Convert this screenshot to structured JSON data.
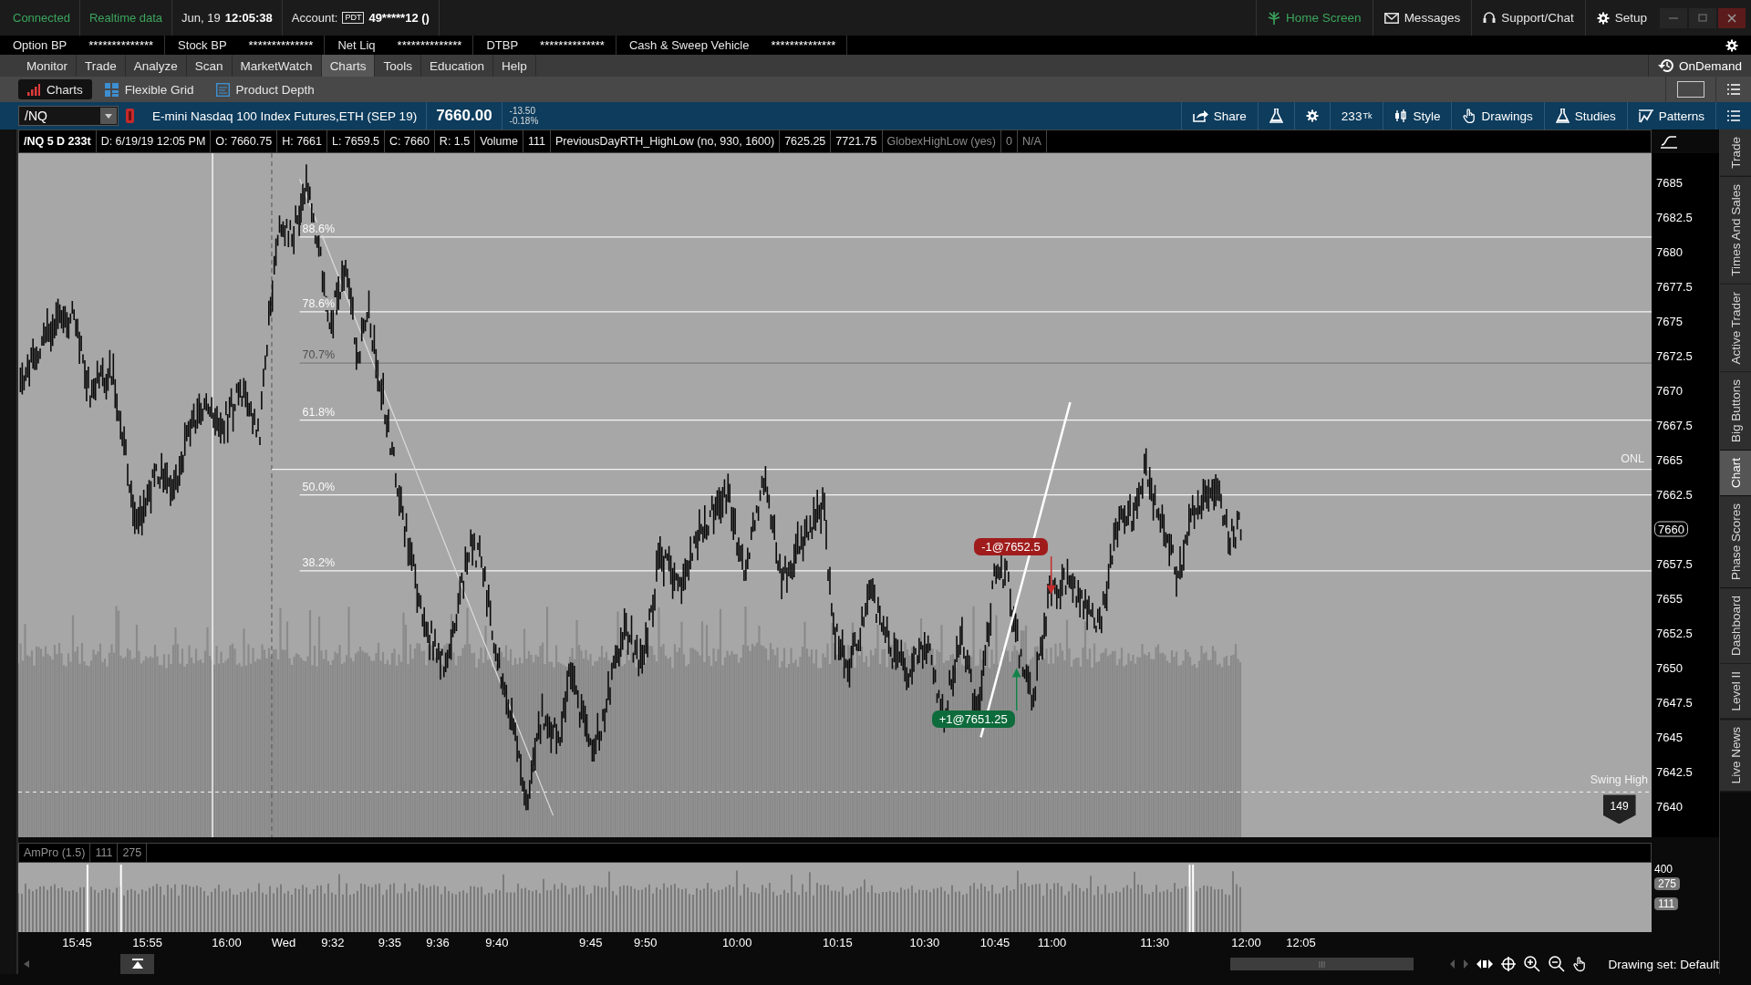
{
  "status_bar": {
    "connection": "Connected",
    "data_feed": "Realtime data",
    "date": "Jun, 19",
    "time": "12:05:38",
    "account_label": "Account:",
    "account_badge": "PDT",
    "account": "49*****12 ()"
  },
  "header_links": [
    {
      "label": "Home Screen",
      "selected": true
    },
    {
      "label": "Messages",
      "selected": false
    },
    {
      "label": "Support/Chat",
      "selected": false
    },
    {
      "label": "Setup",
      "selected": false
    }
  ],
  "balances": [
    {
      "label": "Option BP",
      "value": "**************"
    },
    {
      "label": "Stock BP",
      "value": "**************"
    },
    {
      "label": "Net Liq",
      "value": "**************"
    },
    {
      "label": "DTBP",
      "value": "**************"
    },
    {
      "label": "Cash & Sweep Vehicle",
      "value": "**************"
    }
  ],
  "main_tabs": [
    {
      "label": "Monitor",
      "selected": false
    },
    {
      "label": "Trade",
      "selected": false
    },
    {
      "label": "Analyze",
      "selected": false
    },
    {
      "label": "Scan",
      "selected": false
    },
    {
      "label": "MarketWatch",
      "selected": false
    },
    {
      "label": "Charts",
      "selected": true
    },
    {
      "label": "Tools",
      "selected": false
    },
    {
      "label": "Education",
      "selected": false
    },
    {
      "label": "Help",
      "selected": false
    }
  ],
  "on_demand": "OnDemand",
  "sub_tabs": [
    {
      "label": "Charts",
      "selected": true
    },
    {
      "label": "Flexible Grid",
      "selected": false
    },
    {
      "label": "Product Depth",
      "selected": false
    }
  ],
  "symbol": {
    "value": "/NQ",
    "description": "E-mini Nasdaq 100 Index Futures,ETH (SEP 19)",
    "price": "7660.00",
    "change": "-13.50",
    "change_pct": "-0.18%"
  },
  "chart_toolbar": {
    "share": "Share",
    "aggregation": "233",
    "aggregation_unit": "Tk",
    "buttons": [
      "Style",
      "Drawings",
      "Studies",
      "Patterns"
    ]
  },
  "info_bar": [
    {
      "text": "/NQ 5 D 233t",
      "kind": "title"
    },
    {
      "text": "D: 6/19/19 12:05 PM",
      "kind": "value"
    },
    {
      "text": "O: 7660.75",
      "kind": "value"
    },
    {
      "text": "H: 7661",
      "kind": "value"
    },
    {
      "text": "L: 7659.5",
      "kind": "value"
    },
    {
      "text": "C: 7660",
      "kind": "value"
    },
    {
      "text": "R: 1.5",
      "kind": "value"
    },
    {
      "text": "Volume",
      "kind": "value"
    },
    {
      "text": "111",
      "kind": "value"
    },
    {
      "text": "PreviousDayRTH_HighLow (no, 930, 1600)",
      "kind": "value"
    },
    {
      "text": "7625.25",
      "kind": "value"
    },
    {
      "text": "7721.75",
      "kind": "value"
    },
    {
      "text": "GlobexHighLow (yes)",
      "kind": "dim"
    },
    {
      "text": "0",
      "kind": "dim"
    },
    {
      "text": "N/A",
      "kind": "dim"
    }
  ],
  "chart": {
    "price_axis": [
      {
        "label": "7685",
        "current": false
      },
      {
        "label": "7682.5",
        "current": false
      },
      {
        "label": "7680",
        "current": false
      },
      {
        "label": "7677.5",
        "current": false
      },
      {
        "label": "7675",
        "current": false
      },
      {
        "label": "7672.5",
        "current": false
      },
      {
        "label": "7670",
        "current": false
      },
      {
        "label": "7667.5",
        "current": false
      },
      {
        "label": "7665",
        "current": false
      },
      {
        "label": "7662.5",
        "current": false
      },
      {
        "label": "7660",
        "current": true
      },
      {
        "label": "7657.5",
        "current": false
      },
      {
        "label": "7655",
        "current": false
      },
      {
        "label": "7652.5",
        "current": false
      },
      {
        "label": "7650",
        "current": false
      },
      {
        "label": "7647.5",
        "current": false
      },
      {
        "label": "7645",
        "current": false
      },
      {
        "label": "7642.5",
        "current": false
      },
      {
        "label": "7640",
        "current": false
      }
    ],
    "fib_levels": [
      {
        "label": "88.6%",
        "dim": false
      },
      {
        "label": "78.6%",
        "dim": false
      },
      {
        "label": "70.7%",
        "dim": true
      },
      {
        "label": "61.8%",
        "dim": false
      },
      {
        "label": "50.0%",
        "dim": false
      },
      {
        "label": "38.2%",
        "dim": false
      }
    ],
    "onl_label": "ONL",
    "swing_label": "Swing High",
    "swing_count": "149",
    "trades": [
      {
        "kind": "sell",
        "label": "-1@7652.5"
      },
      {
        "kind": "buy",
        "label": "+1@7651.25"
      }
    ]
  },
  "lower_panel": {
    "legend": [
      "AmPro (1.5)",
      "111",
      "275"
    ],
    "axis": [
      "400"
    ],
    "badges": [
      "275",
      "111"
    ]
  },
  "time_axis": [
    "15:45",
    "15:55",
    "16:00",
    "Wed",
    "9:32",
    "9:35",
    "9:36",
    "9:40",
    "9:45",
    "9:50",
    "10:00",
    "10:15",
    "10:30",
    "10:45",
    "11:00",
    "11:30",
    "12:00",
    "12:05"
  ],
  "drawing_set": "Drawing set: Default",
  "side_tabs": [
    {
      "label": "Trade",
      "selected": false
    },
    {
      "label": "Times And Sales",
      "selected": false
    },
    {
      "label": "Active Trader",
      "selected": false
    },
    {
      "label": "Big Buttons",
      "selected": false
    },
    {
      "label": "Chart",
      "selected": true
    },
    {
      "label": "Phase Scores",
      "selected": false
    },
    {
      "label": "Dashboard",
      "selected": false
    },
    {
      "label": "Level II",
      "selected": false
    },
    {
      "label": "Live News",
      "selected": false
    }
  ]
}
